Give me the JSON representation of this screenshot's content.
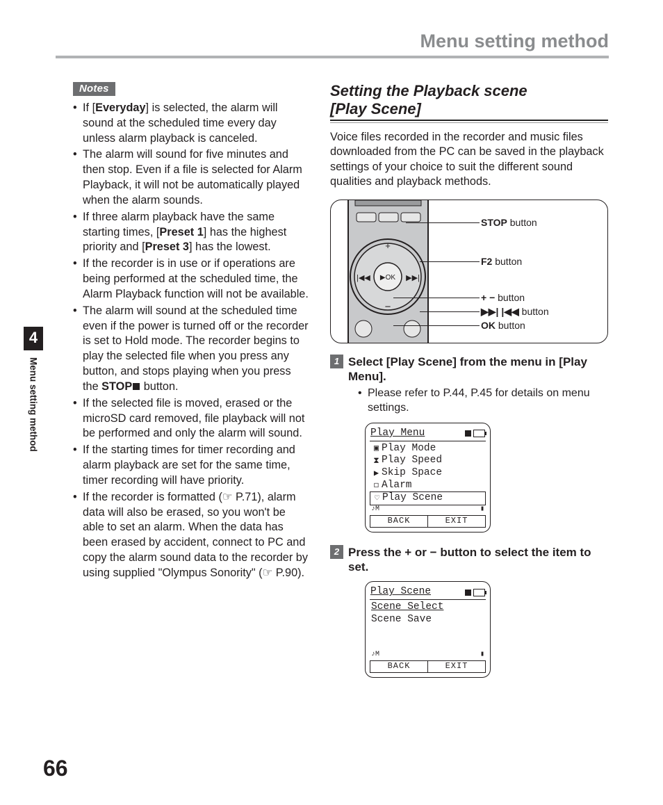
{
  "page": {
    "header": "Menu setting method",
    "number": "66",
    "chapter": "4",
    "side_label": "Menu setting method"
  },
  "notes": {
    "label": "Notes",
    "items": [
      "If [<b>Everyday</b>] is selected, the alarm will sound at the scheduled time every day unless alarm playback is canceled.",
      "The alarm will sound for five minutes and then stop. Even if a file is selected for Alarm Playback, it will not be automatically played when the alarm sounds.",
      "If three alarm playback have the same starting times, [<b>Preset 1</b>] has the highest priority and [<b>Preset 3</b>] has the lowest.",
      "If the recorder is in use or if operations are being performed at the scheduled time, the Alarm Playback function will not be available.",
      "The alarm will sound at the scheduled time even if the power is turned off or the recorder is set to Hold mode. The recorder begins to play the selected file when you press any button, and stops playing when you press the <b>STOP</b><span class=\"stop-sq\"></span> button.",
      "If the selected file is moved, erased or the microSD card removed, file playback will not be performed and only the alarm will sound.",
      "If the starting times for timer recording and alarm playback are set for the same time, timer recording will have priority.",
      "If the recorder is formatted (☞ P.71), alarm data will also be erased, so you won't be able to set an alarm. When the data has been erased by accident, connect to PC and copy the alarm sound data to the recorder by using supplied \"Olympus Sonority\" (☞ P.90)."
    ]
  },
  "right": {
    "subhead_l1": "Setting the Playback scene",
    "subhead_l2": "[Play Scene]",
    "intro": "Voice files recorded in the recorder and music files downloaded from the PC can be saved in the playback settings of your choice to suit the different sound qualities and playback methods.",
    "callouts": {
      "stop": "STOP",
      "stop_suffix": " button",
      "f2": "F2",
      "f2_suffix": " button",
      "pm": "+ −",
      "pm_suffix": " button",
      "skip": "▶▶| |◀◀",
      "skip_suffix": " button",
      "ok": "OK",
      "ok_suffix": " button"
    },
    "step1": {
      "num": "1",
      "text": "Select [<b>Play Scene</b>] from the menu in [<b>Play Menu</b>].",
      "bullet": "Please refer to P.44, P.45 for details on menu settings."
    },
    "lcd1": {
      "title": "Play Menu",
      "rows": [
        "Play Mode",
        "Play Speed",
        "Skip Space",
        "Alarm",
        "Play Scene"
      ],
      "left_soft": "BACK",
      "right_soft": "EXIT",
      "tiny_left": "♪M"
    },
    "step2": {
      "num": "2",
      "text": "Press the <b>+</b> or <b>−</b> button to select the item to set."
    },
    "lcd2": {
      "title": "Play Scene",
      "rows": [
        "Scene Select",
        "Scene Save"
      ],
      "left_soft": "BACK",
      "right_soft": "EXIT",
      "tiny_left": "♪M"
    }
  }
}
